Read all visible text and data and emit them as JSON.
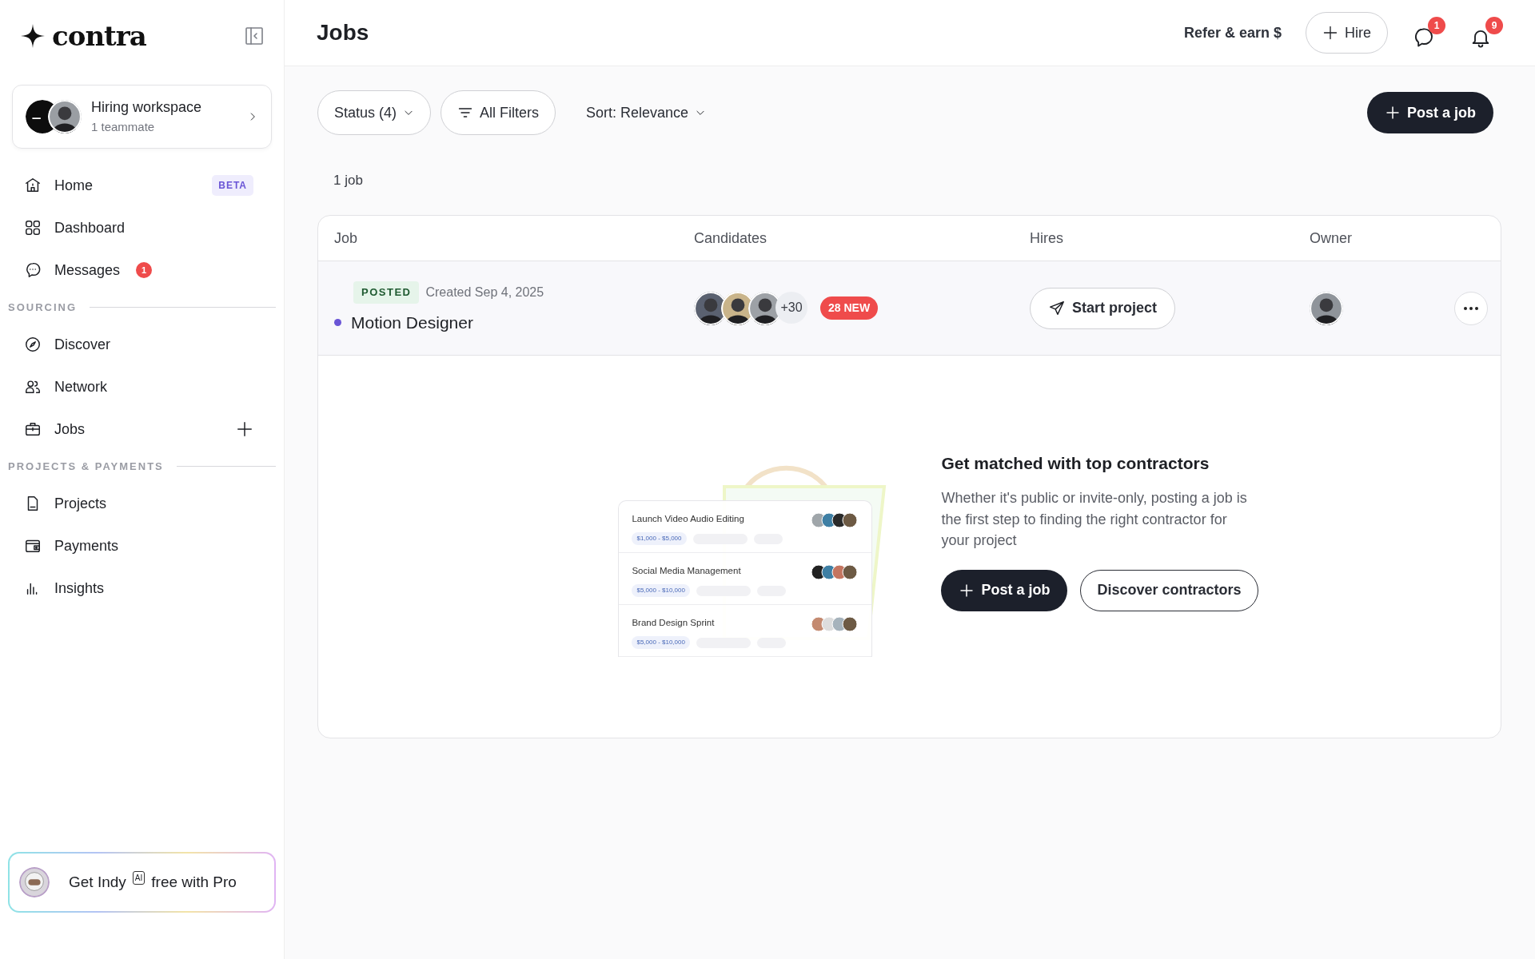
{
  "sidebar": {
    "logo": "contra",
    "workspace": {
      "title": "Hiring workspace",
      "subtitle": "1 teammate"
    },
    "nav": [
      {
        "kind": "link",
        "label": "Home",
        "badge": "BETA"
      },
      {
        "kind": "link",
        "label": "Dashboard"
      },
      {
        "kind": "link",
        "label": "Messages",
        "count": "1"
      },
      {
        "kind": "heading",
        "label": "SOURCING"
      },
      {
        "kind": "link",
        "label": "Discover"
      },
      {
        "kind": "link",
        "label": "Network"
      },
      {
        "kind": "link-add",
        "label": "Jobs"
      },
      {
        "kind": "heading",
        "label": "PROJECTS & PAYMENTS"
      },
      {
        "kind": "link",
        "label": "Projects"
      },
      {
        "kind": "link",
        "label": "Payments"
      },
      {
        "kind": "link",
        "label": "Insights"
      }
    ],
    "promo": {
      "before": "Get Indy",
      "tag": "AI",
      "after": "free with Pro"
    }
  },
  "header": {
    "title": "Jobs",
    "refer": "Refer & earn $",
    "hire": "Hire",
    "messages_count": "1",
    "notifications_count": "9"
  },
  "toolbar": {
    "status": "Status (4)",
    "filters": "All Filters",
    "sort": "Sort: Relevance",
    "post": "Post a job"
  },
  "count_label": "1 job",
  "table": {
    "columns": [
      "Job",
      "Candidates",
      "Hires",
      "Owner"
    ],
    "rows": [
      {
        "status": "POSTED",
        "created": "Created Sep 4, 2025",
        "title": "Motion Designer",
        "candidates_extra": "+30",
        "new_badge": "28 NEW",
        "action": "Start project"
      }
    ]
  },
  "empty_state": {
    "illustration": [
      {
        "title": "Launch Video Audio Editing",
        "range": "$1,000 - $5,000"
      },
      {
        "title": "Social Media Management",
        "range": "$5,000 - $10,000"
      },
      {
        "title": "Brand Design Sprint",
        "range": "$5,000 - $10,000"
      }
    ],
    "heading": "Get matched with top contractors",
    "body": "Whether it's public or invite-only, posting a job is the first step to finding the right contractor for your project",
    "primary": "Post a job",
    "secondary": "Discover contractors"
  }
}
